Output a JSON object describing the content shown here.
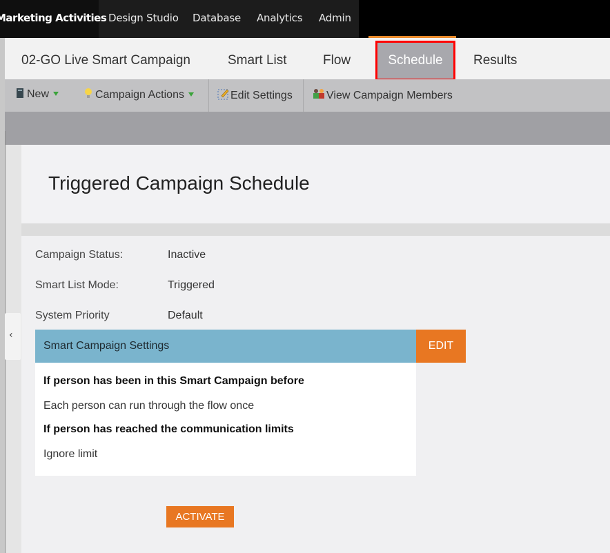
{
  "topnav": {
    "items": [
      "Marketing Activities",
      "Design Studio",
      "Database",
      "Analytics",
      "Admin"
    ]
  },
  "tabs": {
    "campaign_name": "02-GO Live Smart Campaign",
    "smart_list": "Smart List",
    "flow": "Flow",
    "schedule": "Schedule",
    "results": "Results",
    "active": "Schedule"
  },
  "toolbar": {
    "new_label": "New",
    "campaign_actions_label": "Campaign Actions",
    "edit_settings_label": "Edit Settings",
    "view_members_label": "View Campaign Members"
  },
  "page": {
    "title": "Triggered Campaign Schedule"
  },
  "fields": {
    "campaign_status_label": "Campaign Status:",
    "campaign_status_value": "Inactive",
    "smart_list_mode_label": "Smart List Mode:",
    "smart_list_mode_value": "Triggered",
    "system_priority_label": "System Priority",
    "system_priority_value": "Default"
  },
  "settings": {
    "header": "Smart Campaign Settings",
    "edit_label": "EDIT",
    "heading1": "If person has been in this Smart Campaign before",
    "text1": "Each person can run through the flow once",
    "heading2": "If person has reached the communication limits",
    "text2": "Ignore limit"
  },
  "activate_label": "ACTIVATE",
  "colors": {
    "accent_orange": "#e87722",
    "settings_header_blue": "#7ab4cd",
    "highlight_red": "#ff0000"
  },
  "icons": {
    "new": "document-icon",
    "campaign_actions": "lightbulb-icon",
    "edit_settings": "pencil-edit-icon",
    "view_members": "people-icon",
    "collapse": "chevron-left-icon"
  }
}
